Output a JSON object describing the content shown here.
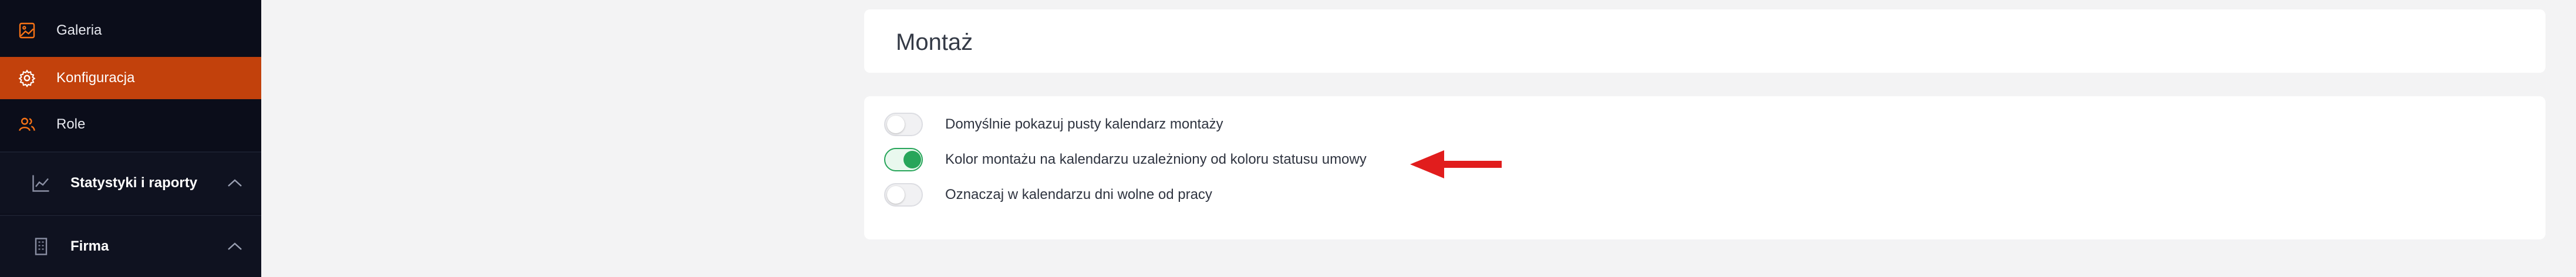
{
  "sidebar": {
    "items": [
      {
        "label": "Galeria",
        "icon": "image-icon",
        "active": false
      },
      {
        "label": "Konfiguracja",
        "icon": "gear-icon",
        "active": true
      },
      {
        "label": "Role",
        "icon": "users-icon",
        "active": false
      }
    ],
    "sections": [
      {
        "label": "Statystyki i raporty",
        "icon": "chart-icon",
        "expanded": true
      },
      {
        "label": "Firma",
        "icon": "building-icon",
        "expanded": true
      }
    ]
  },
  "main": {
    "title": "Montaż",
    "options": [
      {
        "label": "Domyślnie pokazuj pusty kalendarz montaży",
        "checked": false
      },
      {
        "label": "Kolor montażu na kalendarzu uzależniony od koloru statusu umowy",
        "checked": true
      },
      {
        "label": "Oznaczaj w kalendarzu dni wolne od pracy",
        "checked": false
      }
    ]
  },
  "colors": {
    "sidebar_bg": "#0b0d1a",
    "active_accent": "#c2410c",
    "toggle_on": "#27a55a",
    "annotation_arrow": "#e11d1d"
  }
}
